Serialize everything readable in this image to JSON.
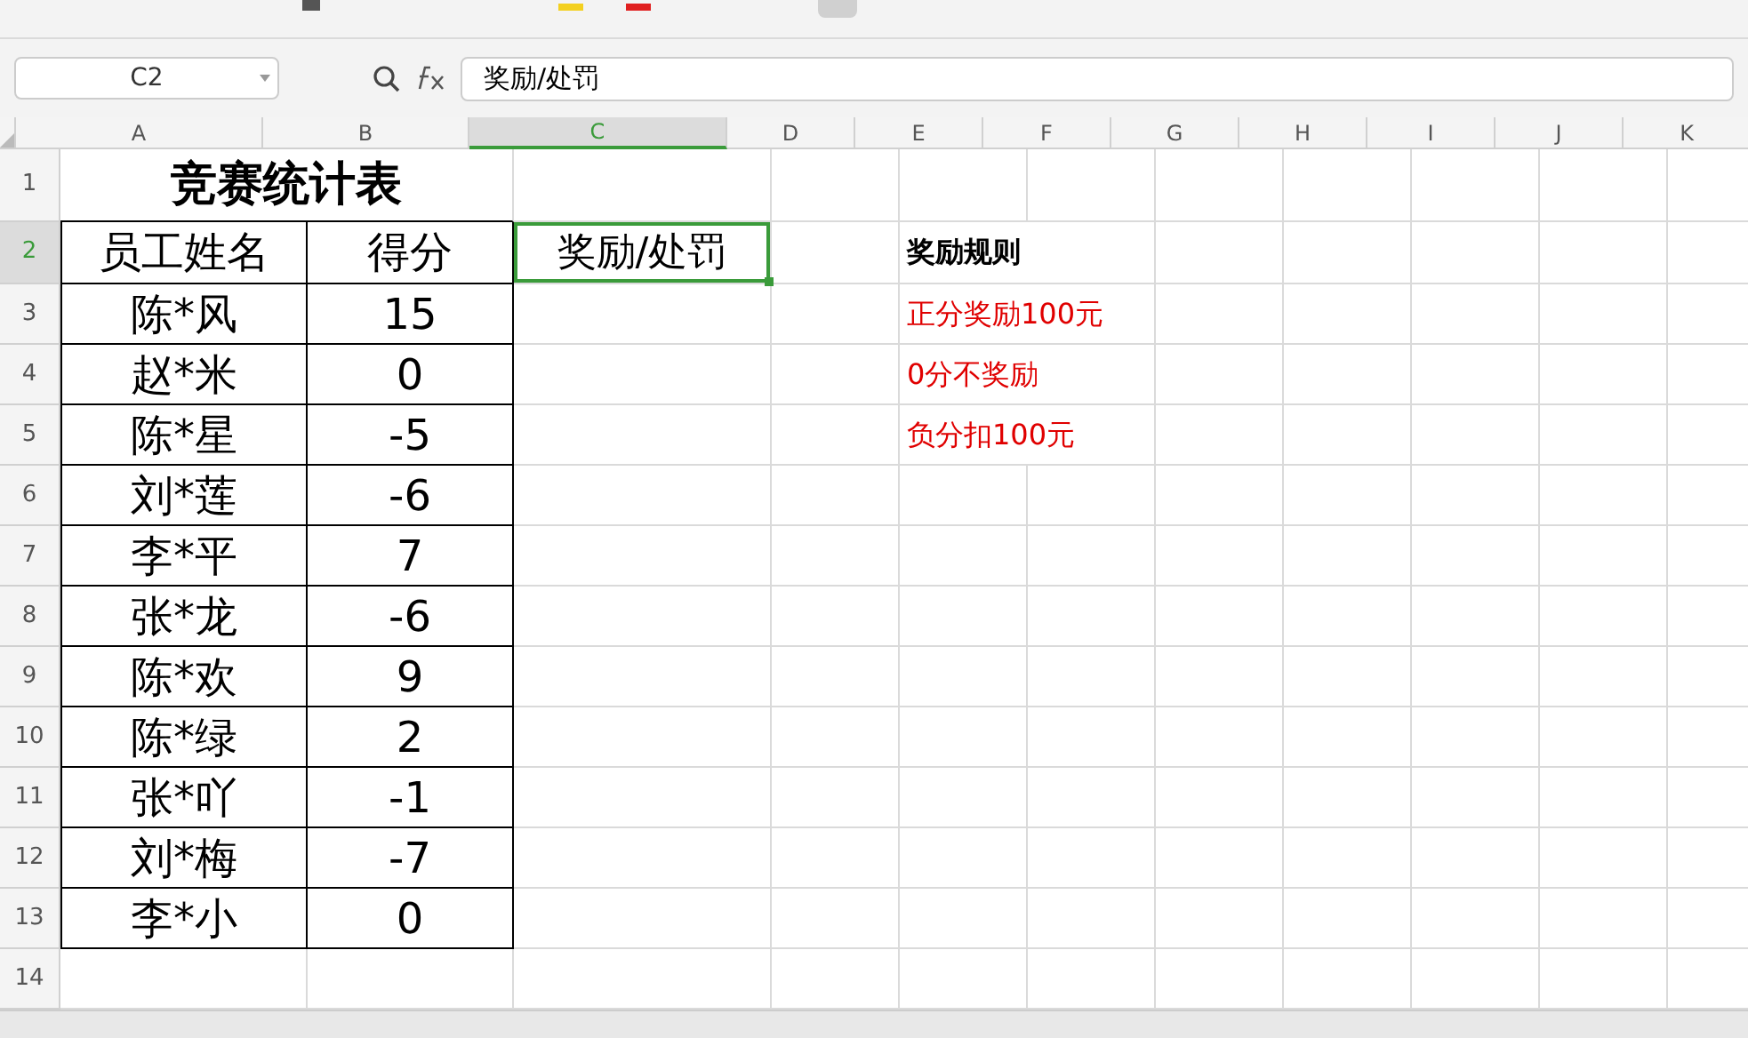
{
  "name_box": "C2",
  "formula": {
    "value": "奖励/处罚"
  },
  "columns": [
    {
      "label": "A",
      "selected": false
    },
    {
      "label": "B",
      "selected": false
    },
    {
      "label": "C",
      "selected": true
    },
    {
      "label": "D",
      "selected": false
    },
    {
      "label": "E",
      "selected": false
    },
    {
      "label": "F",
      "selected": false
    },
    {
      "label": "G",
      "selected": false
    },
    {
      "label": "H",
      "selected": false
    },
    {
      "label": "I",
      "selected": false
    },
    {
      "label": "J",
      "selected": false
    },
    {
      "label": "K",
      "selected": false
    }
  ],
  "row_numbers": [
    {
      "label": "1",
      "selected": false
    },
    {
      "label": "2",
      "selected": true
    },
    {
      "label": "3",
      "selected": false
    },
    {
      "label": "4",
      "selected": false
    },
    {
      "label": "5",
      "selected": false
    },
    {
      "label": "6",
      "selected": false
    },
    {
      "label": "7",
      "selected": false
    },
    {
      "label": "8",
      "selected": false
    },
    {
      "label": "9",
      "selected": false
    },
    {
      "label": "10",
      "selected": false
    },
    {
      "label": "11",
      "selected": false
    },
    {
      "label": "12",
      "selected": false
    },
    {
      "label": "13",
      "selected": false
    },
    {
      "label": "14",
      "selected": false
    }
  ],
  "title": "竞赛统计表",
  "table": {
    "columns": [
      "员工姓名",
      "得分"
    ],
    "rows": [
      [
        "陈*风",
        "15"
      ],
      [
        "赵*米",
        "0"
      ],
      [
        "陈*星",
        "-5"
      ],
      [
        "刘*莲",
        "-6"
      ],
      [
        "李*平",
        "7"
      ],
      [
        "张*龙",
        "-6"
      ],
      [
        "陈*欢",
        "9"
      ],
      [
        "陈*绿",
        "2"
      ],
      [
        "张*吖",
        "-1"
      ],
      [
        "刘*梅",
        "-7"
      ],
      [
        "李*小",
        "0"
      ]
    ]
  },
  "selected_cell": {
    "value": "奖励/处罚"
  },
  "rules": {
    "title": "奖励规则",
    "items": [
      "正分奖励100元",
      "0分不奖励",
      "负分扣100元"
    ]
  }
}
